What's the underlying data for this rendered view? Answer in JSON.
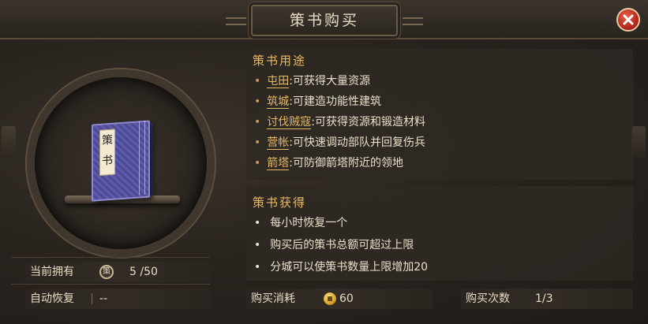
{
  "window": {
    "title": "策书购买"
  },
  "close_icon": "close-icon",
  "item": {
    "name": "策书",
    "spine_label": "策书"
  },
  "usage": {
    "title": "策书用途",
    "items": [
      {
        "keyword": "屯田",
        "text": ":可获得大量资源"
      },
      {
        "keyword": "筑城",
        "text": ":可建造功能性建筑"
      },
      {
        "keyword": "讨伐贼寇",
        "text": ":可获得资源和锻造材料"
      },
      {
        "keyword": "营帐",
        "text": ":可快速调动部队并回复伤兵"
      },
      {
        "keyword": "箭塔",
        "text": ":可防御箭塔附近的领地"
      }
    ]
  },
  "obtain": {
    "title": "策书获得",
    "items": [
      "每小时恢复一个",
      "购买后的策书总额可超过上限",
      "分城可以使策书数量上限增加20"
    ]
  },
  "stats": {
    "owned_label": "当前拥有",
    "owned_icon": "策",
    "owned_value": "5 /50",
    "recover_label": "自动恢复",
    "recover_value": "--",
    "cost_label": "购买消耗",
    "cost_value": "60",
    "times_label": "购买次数",
    "times_value": "1/3"
  },
  "colors": {
    "accent": "#e6b964",
    "close": "#c0392b",
    "text": "#eae0cc"
  }
}
